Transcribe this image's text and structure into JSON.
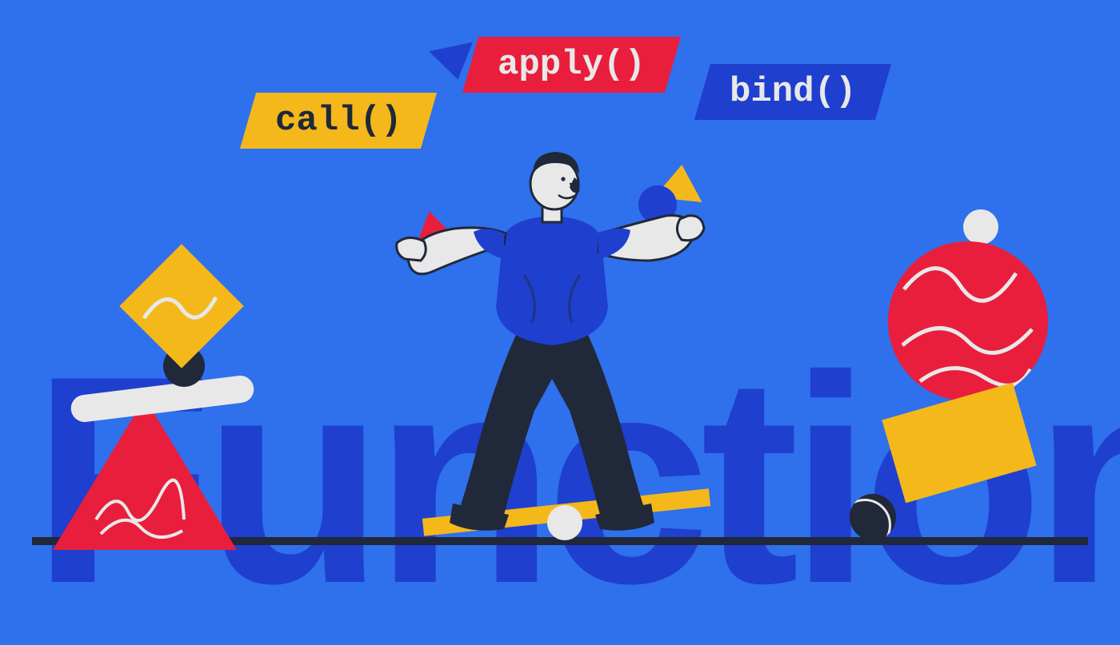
{
  "labels": {
    "call": "call()",
    "apply": "apply()",
    "bind": "bind()"
  },
  "background_word": "Function",
  "colors": {
    "bg": "#2f70ec",
    "deep_blue": "#1f3fcf",
    "red": "#e91e3c",
    "yellow": "#f4b81b",
    "dark": "#20283a",
    "light": "#e8e8e8"
  },
  "icons": {
    "pill_call": "call-pill",
    "pill_apply": "apply-pill",
    "pill_bind": "bind-pill",
    "tri_blue": "triangle-blue-icon",
    "tri_yellow": "triangle-yellow-icon",
    "tri_red": "triangle-red-icon",
    "left_diamond": "diamond-yellow-icon",
    "left_triangle": "triangle-red-large-icon",
    "right_circle": "circle-red-large-icon",
    "right_rect": "rect-yellow-icon",
    "pivot_ball": "pivot-ball-icon",
    "seesaw_board": "seesaw-board-icon",
    "juggle_ball": "juggle-ball-icon",
    "person": "juggler-person-icon",
    "bg_word": "background-word",
    "baseline": "baseline-bar"
  }
}
